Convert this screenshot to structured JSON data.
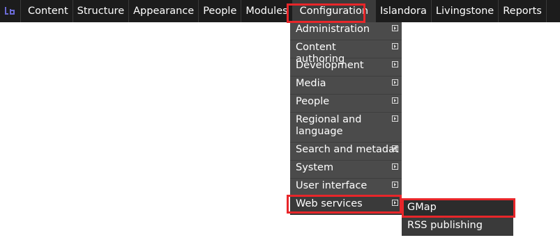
{
  "toolbar": {
    "home_icon": "drupal-logo-icon",
    "items": [
      {
        "label": "Content"
      },
      {
        "label": "Structure"
      },
      {
        "label": "Appearance"
      },
      {
        "label": "People"
      },
      {
        "label": "Modules"
      },
      {
        "label": "Configuration"
      },
      {
        "label": "Islandora"
      },
      {
        "label": "Livingstone"
      },
      {
        "label": "Reports"
      }
    ]
  },
  "configuration_menu": {
    "items": [
      {
        "label": "Administration"
      },
      {
        "label": "Content authoring"
      },
      {
        "label": "Development"
      },
      {
        "label": "Media"
      },
      {
        "label": "People"
      },
      {
        "label": "Regional and language"
      },
      {
        "label": "Search and metadata"
      },
      {
        "label": "System"
      },
      {
        "label": "User interface"
      },
      {
        "label": "Web services"
      }
    ],
    "arrow_icon": "submenu-arrow-icon"
  },
  "web_services_menu": {
    "items": [
      {
        "label": "GMap"
      },
      {
        "label": "RSS publishing"
      }
    ]
  },
  "colors": {
    "toolbar_bg": "#1c1c1c",
    "menu_bg": "#4b4b4b",
    "highlight": "#e8262a"
  }
}
